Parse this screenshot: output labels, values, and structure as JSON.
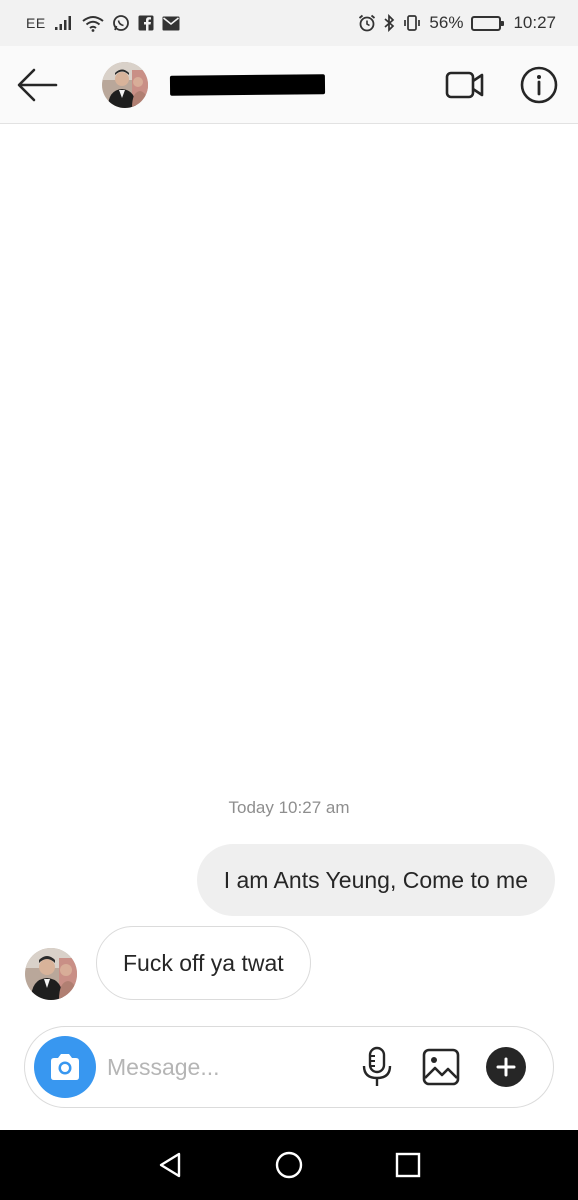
{
  "status_bar": {
    "carrier": "EE",
    "battery_percent": "56%",
    "battery_level": 0.56,
    "time": "10:27",
    "icons": [
      "signal-icon",
      "wifi-icon",
      "whatsapp-icon",
      "facebook-icon",
      "mail-icon",
      "alarm-icon",
      "bluetooth-icon",
      "vibrate-icon",
      "battery-icon"
    ]
  },
  "header": {
    "contact_name": "",
    "name_redacted": true,
    "icons": [
      "back-arrow-icon",
      "video-call-icon",
      "info-icon"
    ]
  },
  "chat": {
    "timestamp": "Today 10:27 am",
    "messages": [
      {
        "direction": "outgoing",
        "text": "I am Ants Yeung, Come to me"
      },
      {
        "direction": "incoming",
        "text": "Fuck off ya twat"
      }
    ]
  },
  "composer": {
    "placeholder": "Message...",
    "value": "",
    "icons": [
      "camera-icon",
      "microphone-icon",
      "gallery-icon",
      "plus-icon"
    ],
    "camera_color": "#3897f0"
  },
  "nav_bar": {
    "icons": [
      "nav-back-icon",
      "nav-home-icon",
      "nav-recents-icon"
    ]
  }
}
